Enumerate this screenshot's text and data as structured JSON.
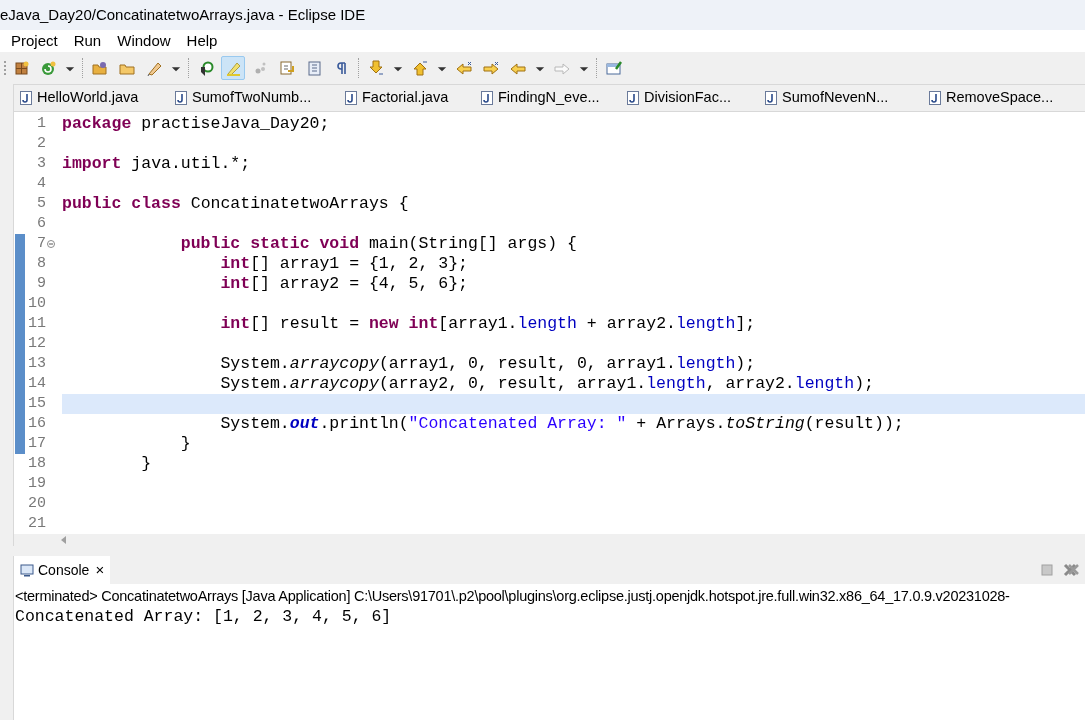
{
  "window": {
    "title": "eJava_Day20/ConcatinatetwoArrays.java - Eclipse IDE"
  },
  "menu": [
    "Project",
    "Run",
    "Window",
    "Help"
  ],
  "toolbar": [
    {
      "kind": "package",
      "selected": false
    },
    {
      "kind": "run",
      "selected": false
    },
    {
      "kind": "dropdown",
      "selected": false
    },
    {
      "kind": "folder-open",
      "selected": false
    },
    {
      "kind": "folder",
      "selected": false
    },
    {
      "kind": "pen",
      "selected": false
    },
    {
      "kind": "dropdown",
      "selected": false
    },
    {
      "kind": "search",
      "selected": false
    },
    {
      "kind": "highlight",
      "selected": true
    },
    {
      "kind": "dots",
      "selected": false
    },
    {
      "kind": "doc-arrow",
      "selected": false
    },
    {
      "kind": "doc",
      "selected": false
    },
    {
      "kind": "pilcrow",
      "selected": false
    },
    {
      "kind": "down-arrow",
      "selected": false
    },
    {
      "kind": "dropdown",
      "selected": false
    },
    {
      "kind": "up-arrow",
      "selected": false
    },
    {
      "kind": "dropdown",
      "selected": false
    },
    {
      "kind": "prev-edit",
      "selected": false
    },
    {
      "kind": "next-edit",
      "selected": false
    },
    {
      "kind": "back",
      "selected": false
    },
    {
      "kind": "dropdown",
      "selected": false
    },
    {
      "kind": "forward",
      "selected": false
    },
    {
      "kind": "dropdown",
      "selected": false
    },
    {
      "kind": "window",
      "selected": false
    }
  ],
  "tabs": [
    {
      "label": "HelloWorld.java",
      "selected": false
    },
    {
      "label": "SumofTwoNumb...",
      "selected": false
    },
    {
      "label": "Factorial.java",
      "selected": false
    },
    {
      "label": "FindingN_eve...",
      "selected": false
    },
    {
      "label": "DivisionFac...",
      "selected": false
    },
    {
      "label": "SumofNevenN...",
      "selected": false
    },
    {
      "label": "RemoveSpace...",
      "selected": false
    }
  ],
  "editor": {
    "lines": [
      {
        "number": "1",
        "changed": false,
        "current": false,
        "foldable": false,
        "tokens": [
          {
            "kind": "keyword",
            "text": "package"
          },
          {
            "kind": "plain",
            "text": " practiseJava_Day20;"
          }
        ]
      },
      {
        "number": "2",
        "changed": false,
        "current": false,
        "foldable": false
      },
      {
        "number": "3",
        "changed": false,
        "current": false,
        "foldable": false,
        "tokens": [
          {
            "kind": "keyword",
            "text": "import"
          },
          {
            "kind": "plain",
            "text": " java.util.*;"
          }
        ]
      },
      {
        "number": "4",
        "changed": false,
        "current": false,
        "foldable": false
      },
      {
        "number": "5",
        "changed": false,
        "current": false,
        "foldable": false,
        "tokens": [
          {
            "kind": "keyword",
            "text": "public class"
          },
          {
            "kind": "plain",
            "text": " ConcatinatetwoArrays {"
          }
        ]
      },
      {
        "number": "6",
        "changed": false,
        "current": false,
        "foldable": false
      },
      {
        "number": "7",
        "changed": true,
        "current": false,
        "foldable": true,
        "tokens": [
          {
            "kind": "keyword",
            "text": "            public static void"
          },
          {
            "kind": "plain",
            "text": " main(String[] args) {"
          }
        ]
      },
      {
        "number": "8",
        "changed": true,
        "current": false,
        "foldable": false,
        "tokens": [
          {
            "kind": "keyword",
            "text": "                int"
          },
          {
            "kind": "plain",
            "text": "[] array1 = {1, 2, 3};"
          }
        ]
      },
      {
        "number": "9",
        "changed": true,
        "current": false,
        "foldable": false,
        "tokens": [
          {
            "kind": "keyword",
            "text": "                int"
          },
          {
            "kind": "plain",
            "text": "[] array2 = {4, 5, 6};"
          }
        ]
      },
      {
        "number": "10",
        "changed": true,
        "current": false,
        "foldable": false
      },
      {
        "number": "11",
        "changed": true,
        "current": false,
        "foldable": false,
        "tokens": [
          {
            "kind": "keyword",
            "text": "                int"
          },
          {
            "kind": "plain",
            "text": "[] result = "
          },
          {
            "kind": "keyword",
            "text": "new int"
          },
          {
            "kind": "plain",
            "text": "[array1."
          },
          {
            "kind": "field",
            "text": "length"
          },
          {
            "kind": "plain",
            "text": " + array2."
          },
          {
            "kind": "field",
            "text": "length"
          },
          {
            "kind": "plain",
            "text": "];"
          }
        ]
      },
      {
        "number": "12",
        "changed": true,
        "current": false,
        "foldable": false
      },
      {
        "number": "13",
        "changed": true,
        "current": false,
        "foldable": false,
        "tokens": [
          {
            "kind": "plain",
            "text": "                System."
          },
          {
            "kind": "static-method",
            "text": "arraycopy"
          },
          {
            "kind": "plain",
            "text": "(array1, 0, result, 0, array1."
          },
          {
            "kind": "field",
            "text": "length"
          },
          {
            "kind": "plain",
            "text": ");"
          }
        ]
      },
      {
        "number": "14",
        "changed": true,
        "current": false,
        "foldable": false,
        "tokens": [
          {
            "kind": "plain",
            "text": "                System."
          },
          {
            "kind": "static-method",
            "text": "arraycopy"
          },
          {
            "kind": "plain",
            "text": "(array2, 0, result, array1."
          },
          {
            "kind": "field",
            "text": "length"
          },
          {
            "kind": "plain",
            "text": ", array2."
          },
          {
            "kind": "field",
            "text": "length"
          },
          {
            "kind": "plain",
            "text": ");"
          }
        ]
      },
      {
        "number": "15",
        "changed": true,
        "current": true,
        "foldable": false
      },
      {
        "number": "16",
        "changed": true,
        "current": false,
        "foldable": false,
        "tokens": [
          {
            "kind": "plain",
            "text": "                System."
          },
          {
            "kind": "static-field",
            "text": "out"
          },
          {
            "kind": "plain",
            "text": ".println("
          },
          {
            "kind": "string",
            "text": "\"Concatenated Array: \""
          },
          {
            "kind": "plain",
            "text": " + Arrays."
          },
          {
            "kind": "static-method",
            "text": "toString"
          },
          {
            "kind": "plain",
            "text": "(result));"
          }
        ]
      },
      {
        "number": "17",
        "changed": true,
        "current": false,
        "foldable": false,
        "tokens": [
          {
            "kind": "plain",
            "text": "            }"
          }
        ]
      },
      {
        "number": "18",
        "changed": false,
        "current": false,
        "foldable": false,
        "tokens": [
          {
            "kind": "plain",
            "text": "        }"
          }
        ]
      },
      {
        "number": "19",
        "changed": false,
        "current": false,
        "foldable": false
      },
      {
        "number": "20",
        "changed": false,
        "current": false,
        "foldable": false
      },
      {
        "number": "21",
        "changed": false,
        "current": false,
        "foldable": false
      }
    ]
  },
  "console": {
    "tab": "Console",
    "close": "×",
    "header": "<terminated> ConcatinatetwoArrays [Java Application] C:\\Users\\91701\\.p2\\pool\\plugins\\org.eclipse.justj.openjdk.hotspot.jre.full.win32.x86_64_17.0.9.v20231028-",
    "output": "Concatenated Array: [1, 2, 3, 4, 5, 6]"
  }
}
